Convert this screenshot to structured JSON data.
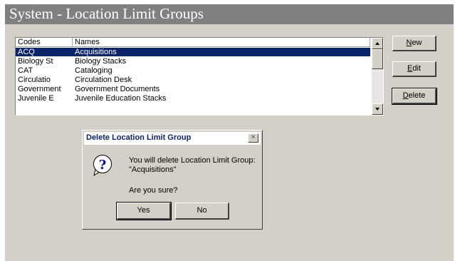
{
  "window": {
    "title": "System - Location Limit Groups"
  },
  "table": {
    "headers": [
      "Codes",
      "Names"
    ],
    "rows": [
      {
        "code": "ACQ",
        "name": "Acquisitions",
        "selected": true
      },
      {
        "code": "Biology St",
        "name": "Biology Stacks"
      },
      {
        "code": "CAT",
        "name": "Cataloging"
      },
      {
        "code": "Circulatio",
        "name": "Circulation Desk"
      },
      {
        "code": "Government",
        "name": "Government Documents"
      },
      {
        "code": "Juvenile E",
        "name": "Juvenile Education Stacks"
      }
    ]
  },
  "buttons": {
    "new": "New",
    "edit": "Edit",
    "delete": "Delete"
  },
  "dialog": {
    "title": "Delete  Location Limit Group",
    "close": "×",
    "line1": "You will delete  Location Limit Group:",
    "line2": "\"Acquisitions\"",
    "question": "Are you sure?",
    "yes": "Yes",
    "no": "No",
    "icon": "question-icon"
  },
  "colors": {
    "selection": "#0a246a",
    "face": "#d4d0c8",
    "titlebar": "#808080"
  }
}
